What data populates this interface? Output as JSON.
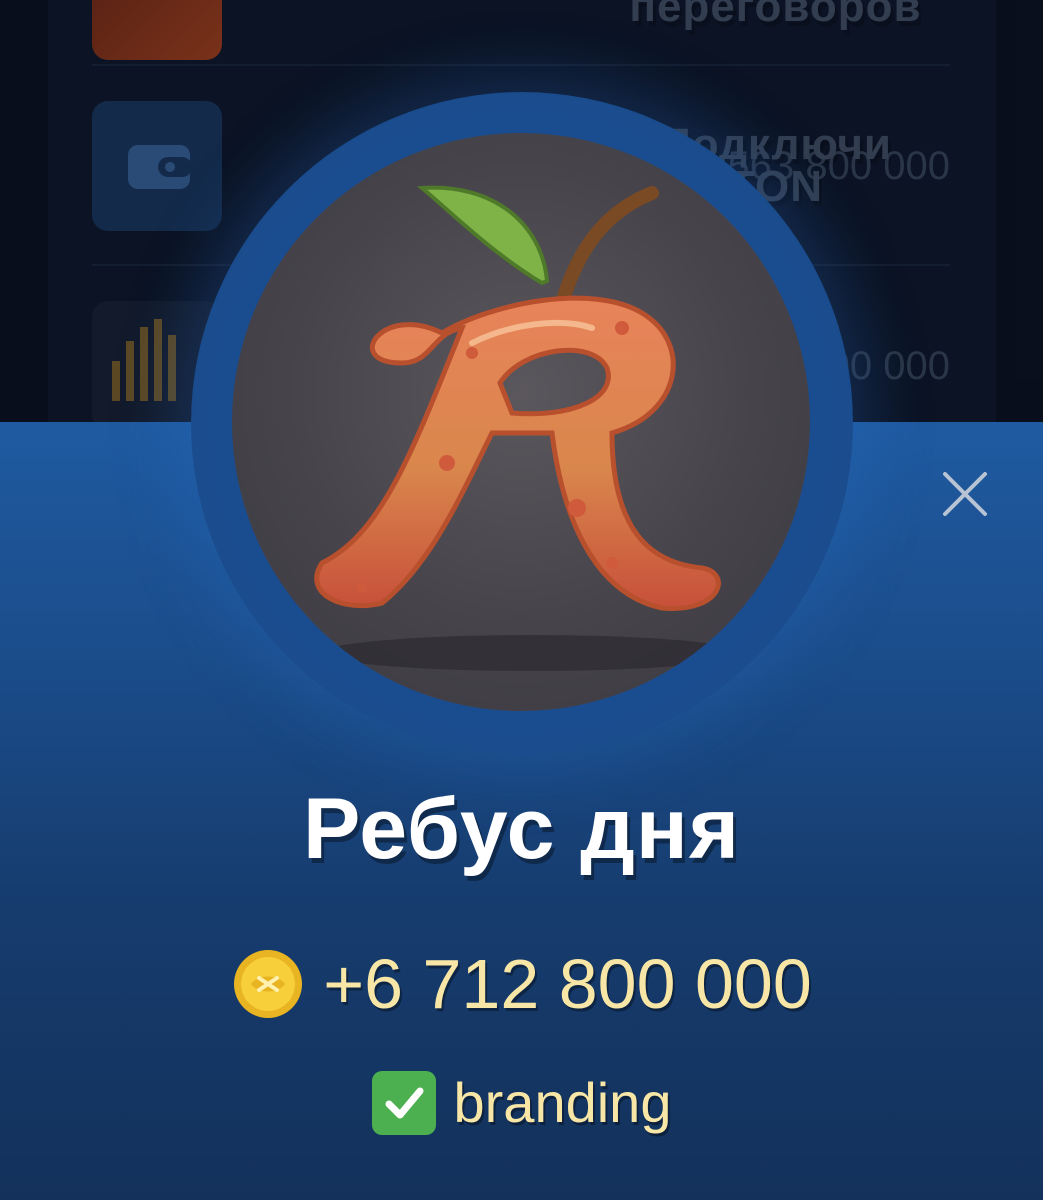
{
  "background": {
    "rows": [
      {
        "title": "переговоров",
        "amount": ""
      },
      {
        "title": "Подключи\nTON",
        "amount": "+33 563 800 000"
      },
      {
        "title": "",
        "amount": "300 000"
      }
    ]
  },
  "sheet": {
    "title": "Ребус дня",
    "reward": "+6 712 800 000",
    "reward_icon": "gold-coin-icon",
    "tag_icon": "check-mark-icon",
    "tag": "branding",
    "close_icon": "close-icon"
  },
  "colors": {
    "accent": "#1f5aa0",
    "reward_text": "#f7e6a6",
    "check_green": "#4caf50"
  }
}
